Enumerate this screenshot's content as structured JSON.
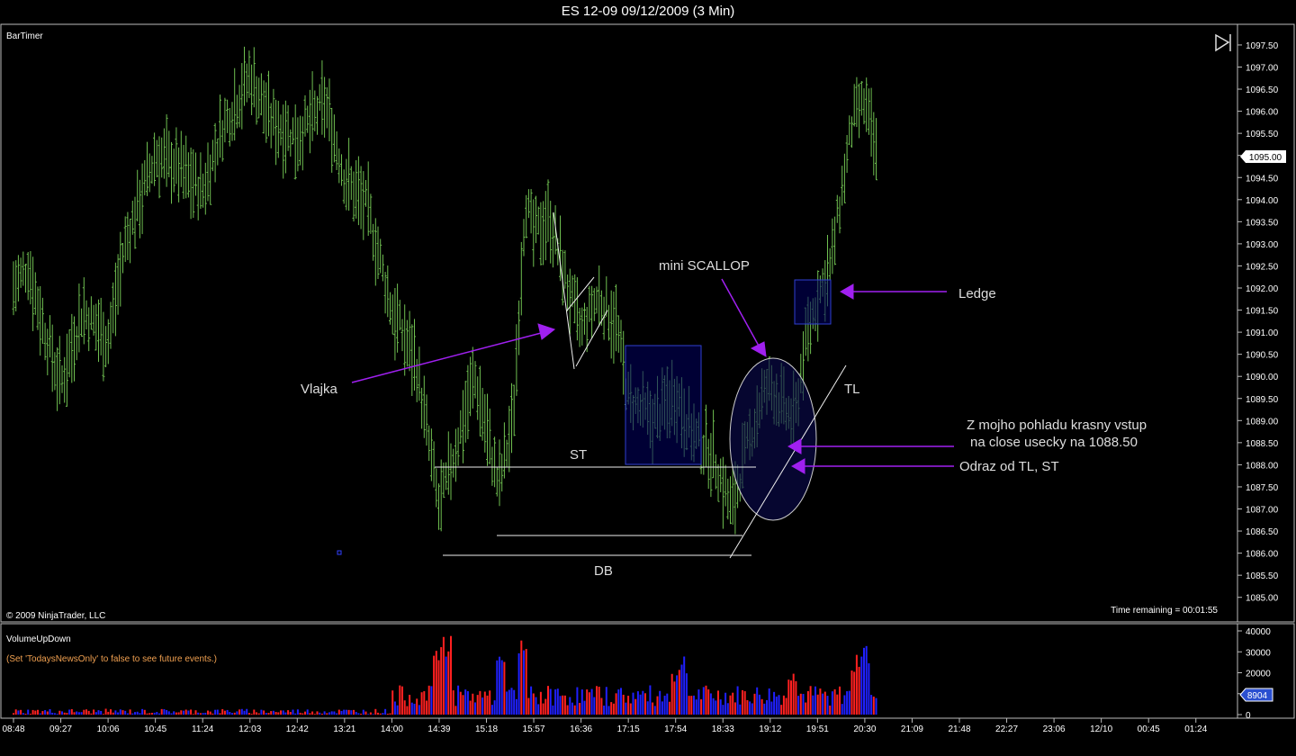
{
  "window": {
    "title": "ES 12-09  09/12/2009 (3 Min)"
  },
  "indicators": {
    "top_left": "BarTimer",
    "bottom_left": "© 2009 NinjaTrader, LLC",
    "time_remaining": "Time remaining = 00:01:55"
  },
  "volume_panel": {
    "title": "VolumeUpDown",
    "note": "(Set 'TodaysNewsOnly' to false to see future events.)"
  },
  "colors": {
    "background": "#000000",
    "price_bars": "#6fbf50",
    "up_volume": "#2020ff",
    "down_volume": "#ff2020",
    "arrows": "#a020f0",
    "annotation_text": "#dddddd",
    "last_volume_marker": "#2a4fd0"
  },
  "annotations": {
    "vlajka": "Vlajka",
    "mini_scallop": "mini SCALLOP",
    "ledge": "Ledge",
    "tl": "TL",
    "st": "ST",
    "db": "DB",
    "entry_line1": "Z mojho pohladu krasny vstup",
    "entry_line2": "na close usecky  na 1088.50",
    "bounce": "Odraz od TL, ST"
  },
  "chart_data": [
    {
      "type": "ohlc",
      "title": "ES 12-09  09/12/2009 (3 Min)",
      "series": [
        {
          "name": "ES 12-09"
        }
      ],
      "ylim": [
        1084.75,
        1097.75
      ],
      "y_ticks": [
        "1085.00",
        "1085.50",
        "1086.00",
        "1086.50",
        "1087.00",
        "1087.50",
        "1088.00",
        "1088.50",
        "1089.00",
        "1089.50",
        "1090.00",
        "1090.50",
        "1091.00",
        "1091.50",
        "1092.00",
        "1092.50",
        "1093.00",
        "1093.50",
        "1094.00",
        "1094.50",
        "1095.00",
        "1095.50",
        "1096.00",
        "1096.50",
        "1097.00",
        "1097.50"
      ],
      "last_price": "1095.00",
      "x_ticks": [
        "08:48",
        "09:27",
        "10:06",
        "10:45",
        "11:24",
        "12:03",
        "12:42",
        "13:21",
        "14:00",
        "14:39",
        "15:18",
        "15:57",
        "16:36",
        "17:15",
        "17:54",
        "18:33",
        "19:12",
        "19:51",
        "20:30",
        "21:09",
        "21:48",
        "22:27",
        "23:06",
        "12/10",
        "00:45",
        "01:24"
      ],
      "anchors": [
        {
          "t": "08:48",
          "p": 1092.0
        },
        {
          "t": "09:00",
          "p": 1092.5
        },
        {
          "t": "09:12",
          "p": 1091.2
        },
        {
          "t": "09:27",
          "p": 1089.8
        },
        {
          "t": "09:45",
          "p": 1091.5
        },
        {
          "t": "10:06",
          "p": 1090.8
        },
        {
          "t": "10:20",
          "p": 1093.0
        },
        {
          "t": "10:45",
          "p": 1095.0
        },
        {
          "t": "11:00",
          "p": 1094.8
        },
        {
          "t": "11:24",
          "p": 1094.2
        },
        {
          "t": "11:40",
          "p": 1095.6
        },
        {
          "t": "12:03",
          "p": 1096.8
        },
        {
          "t": "12:20",
          "p": 1095.8
        },
        {
          "t": "12:42",
          "p": 1095.4
        },
        {
          "t": "13:05",
          "p": 1096.2
        },
        {
          "t": "13:21",
          "p": 1094.5
        },
        {
          "t": "13:40",
          "p": 1093.8
        },
        {
          "t": "14:00",
          "p": 1091.5
        },
        {
          "t": "14:20",
          "p": 1090.3
        },
        {
          "t": "14:39",
          "p": 1087.0
        },
        {
          "t": "14:55",
          "p": 1088.6
        },
        {
          "t": "15:08",
          "p": 1090.0
        },
        {
          "t": "15:18",
          "p": 1088.8
        },
        {
          "t": "15:28",
          "p": 1087.5
        },
        {
          "t": "15:40",
          "p": 1089.0
        },
        {
          "t": "15:50",
          "p": 1094.0
        },
        {
          "t": "15:57",
          "p": 1093.2
        },
        {
          "t": "16:10",
          "p": 1093.6
        },
        {
          "t": "16:25",
          "p": 1092.0
        },
        {
          "t": "16:36",
          "p": 1091.0
        },
        {
          "t": "16:50",
          "p": 1091.8
        },
        {
          "t": "17:05",
          "p": 1091.2
        },
        {
          "t": "17:15",
          "p": 1089.5
        },
        {
          "t": "17:35",
          "p": 1089.0
        },
        {
          "t": "17:54",
          "p": 1089.6
        },
        {
          "t": "18:10",
          "p": 1088.6
        },
        {
          "t": "18:25",
          "p": 1088.2
        },
        {
          "t": "18:40",
          "p": 1087.0
        },
        {
          "t": "18:52",
          "p": 1088.3
        },
        {
          "t": "19:05",
          "p": 1089.5
        },
        {
          "t": "19:12",
          "p": 1089.8
        },
        {
          "t": "19:25",
          "p": 1089.2
        },
        {
          "t": "19:32",
          "p": 1089.0
        },
        {
          "t": "19:40",
          "p": 1090.6
        },
        {
          "t": "19:51",
          "p": 1091.8
        },
        {
          "t": "20:02",
          "p": 1092.5
        },
        {
          "t": "20:10",
          "p": 1094.0
        },
        {
          "t": "20:20",
          "p": 1095.8
        },
        {
          "t": "20:30",
          "p": 1096.2
        },
        {
          "t": "20:40",
          "p": 1094.9
        }
      ]
    },
    {
      "type": "bar",
      "title": "VolumeUpDown",
      "series": [
        {
          "name": "up"
        },
        {
          "name": "down"
        }
      ],
      "ylim": [
        0,
        40000
      ],
      "y_ticks": [
        "0",
        "10000",
        "20000",
        "30000",
        "40000"
      ],
      "last_value": "8904",
      "peaks": [
        {
          "t": "14:39",
          "v": 37000
        },
        {
          "t": "14:45",
          "v": 39500
        },
        {
          "t": "15:30",
          "v": 34000
        },
        {
          "t": "15:48",
          "v": 38000
        },
        {
          "t": "17:54",
          "v": 20000
        },
        {
          "t": "18:00",
          "v": 28000
        },
        {
          "t": "19:30",
          "v": 22000
        },
        {
          "t": "20:22",
          "v": 29000
        },
        {
          "t": "20:30",
          "v": 33000
        }
      ]
    }
  ]
}
